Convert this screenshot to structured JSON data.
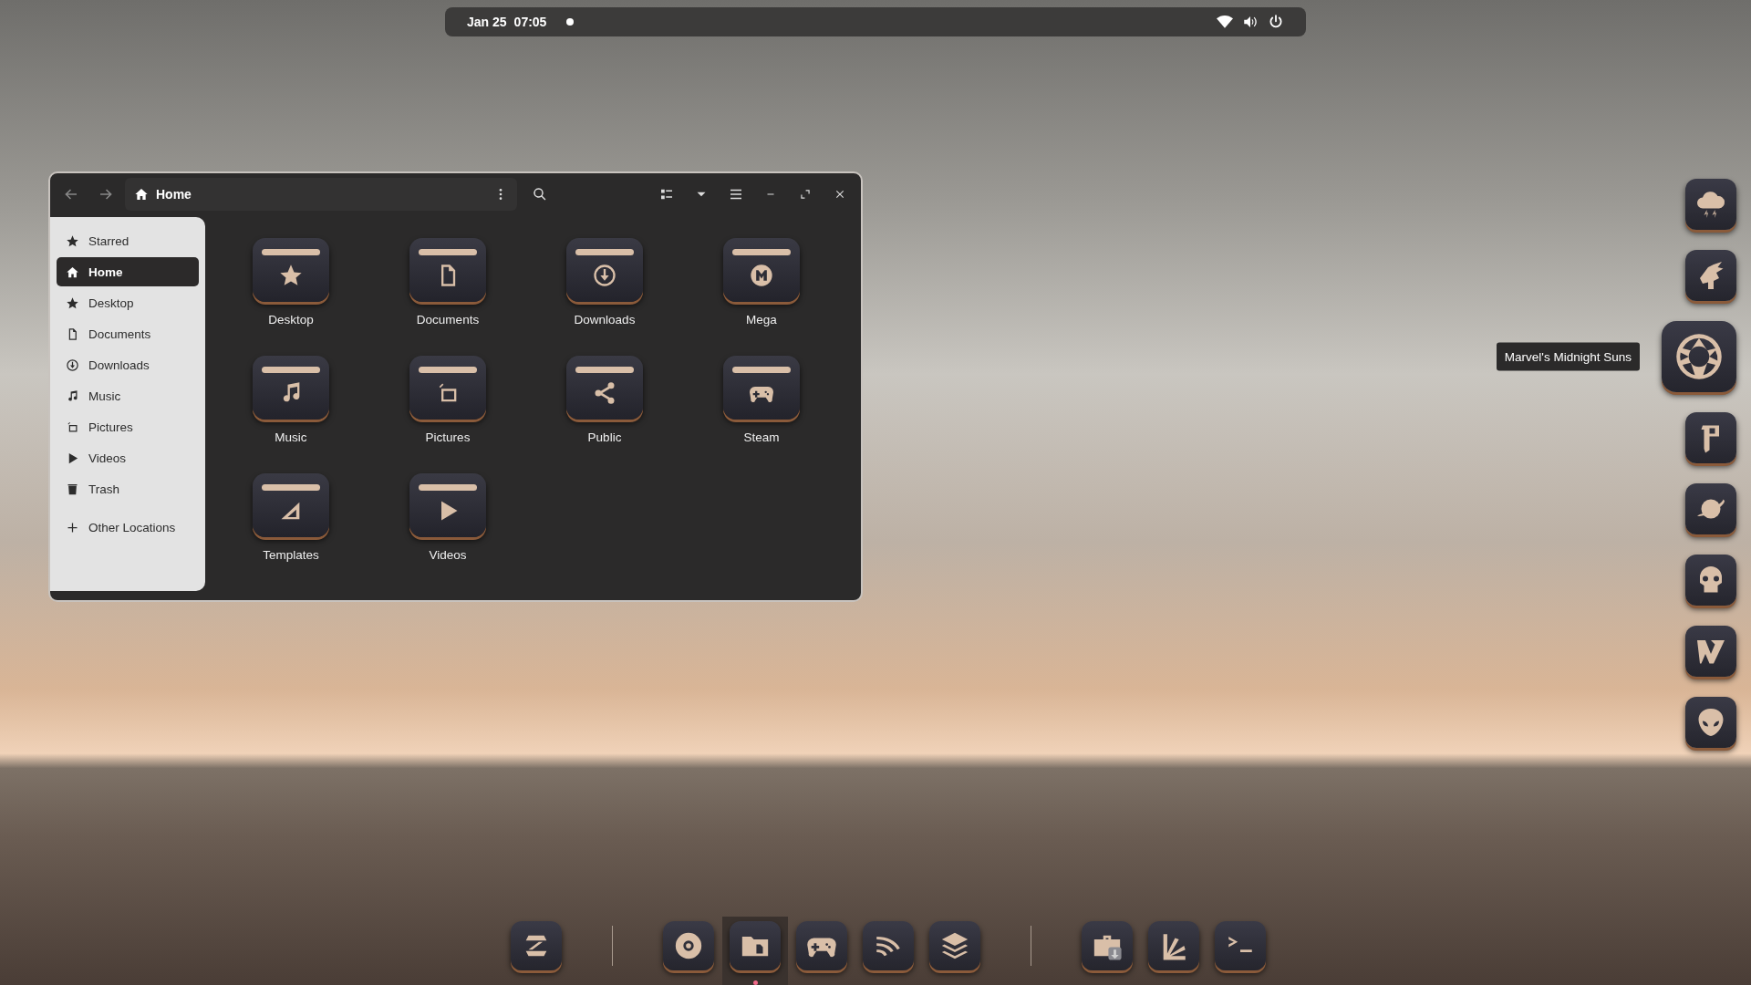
{
  "top_bar": {
    "date": "Jan 25",
    "time": "07:05"
  },
  "file_manager": {
    "path": "Home",
    "sidebar": [
      {
        "label": "Starred",
        "selected": false
      },
      {
        "label": "Home",
        "selected": true
      },
      {
        "label": "Desktop",
        "selected": false
      },
      {
        "label": "Documents",
        "selected": false
      },
      {
        "label": "Downloads",
        "selected": false
      },
      {
        "label": "Music",
        "selected": false
      },
      {
        "label": "Pictures",
        "selected": false
      },
      {
        "label": "Videos",
        "selected": false
      },
      {
        "label": "Trash",
        "selected": false
      },
      {
        "label": "Other Locations",
        "selected": false
      }
    ],
    "folders": [
      {
        "name": "Desktop"
      },
      {
        "name": "Documents"
      },
      {
        "name": "Downloads"
      },
      {
        "name": "Mega"
      },
      {
        "name": "Music"
      },
      {
        "name": "Pictures"
      },
      {
        "name": "Public"
      },
      {
        "name": "Steam"
      },
      {
        "name": "Templates"
      },
      {
        "name": "Videos"
      }
    ]
  },
  "side_dock": {
    "tooltip": "Marvel's Midnight Suns",
    "items": [
      {
        "hovered": false
      },
      {
        "hovered": false
      },
      {
        "hovered": true
      },
      {
        "hovered": false
      },
      {
        "hovered": false
      },
      {
        "hovered": false
      },
      {
        "hovered": false
      },
      {
        "hovered": false
      }
    ]
  },
  "bottom_dock": {
    "items": [
      {
        "running": false
      },
      {
        "running": false
      },
      {
        "running": true
      },
      {
        "running": false
      },
      {
        "running": false
      },
      {
        "running": false
      },
      {
        "running": false
      },
      {
        "running": false
      },
      {
        "running": false
      }
    ]
  }
}
